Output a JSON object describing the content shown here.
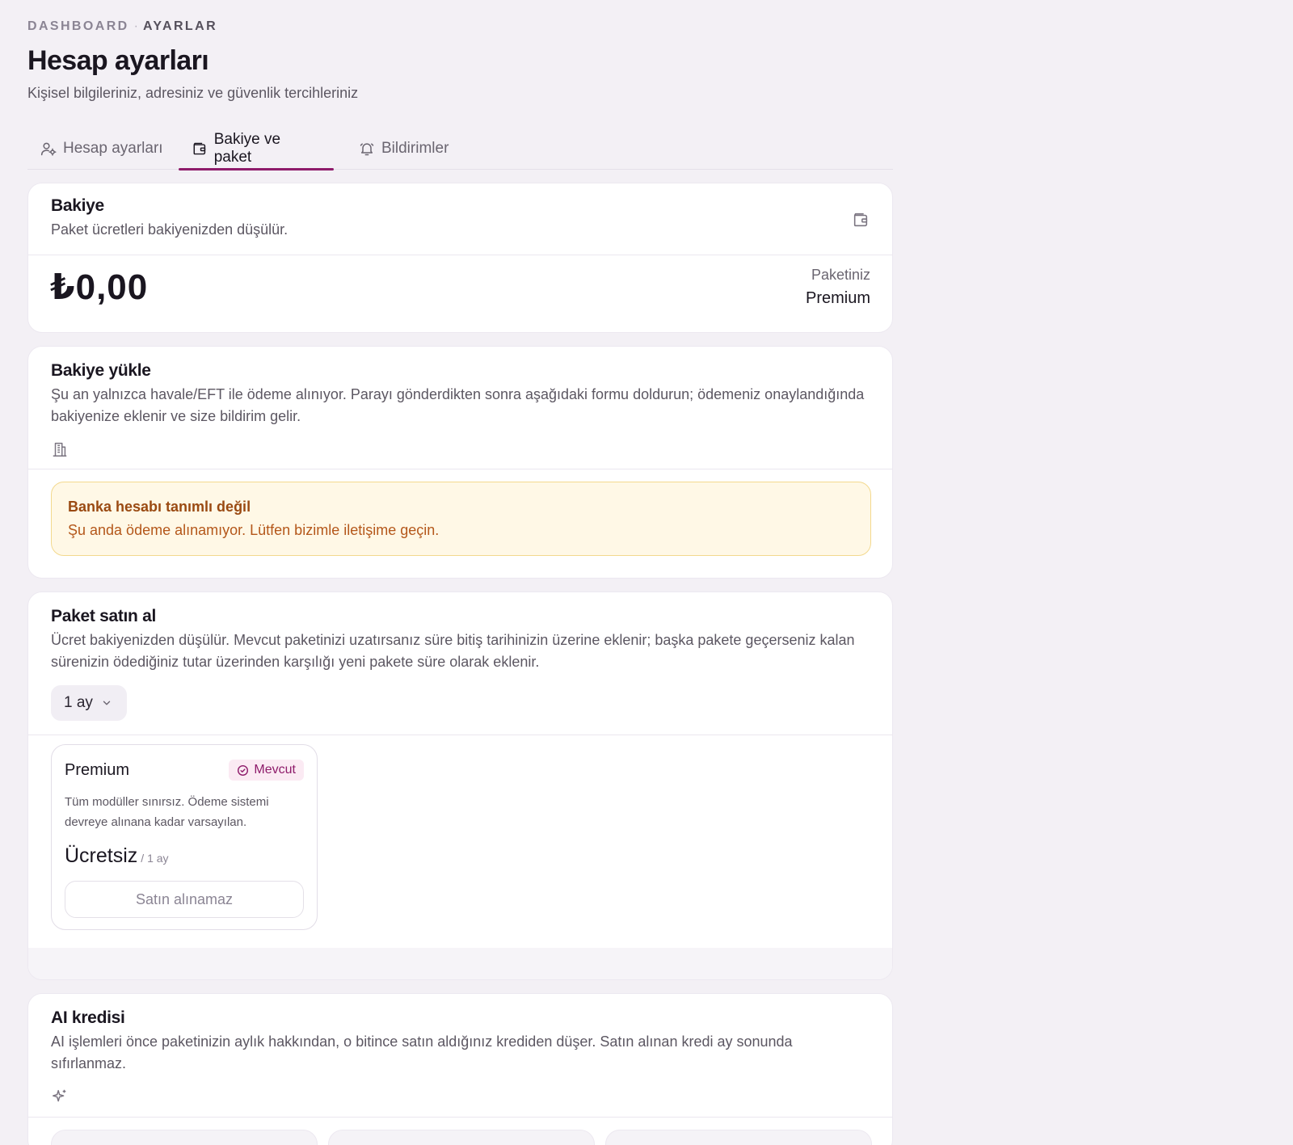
{
  "breadcrumb": {
    "root": "DASHBOARD",
    "separator": "·",
    "current": "AYARLAR"
  },
  "page": {
    "title": "Hesap ayarları",
    "subtitle": "Kişisel bilgileriniz, adresiniz ve güvenlik tercihleriniz"
  },
  "tabs": [
    {
      "label": "Hesap ayarları",
      "icon": "user-settings-icon",
      "active": false
    },
    {
      "label": "Bakiye ve paket",
      "icon": "wallet-icon",
      "active": true
    },
    {
      "label": "Bildirimler",
      "icon": "bell-icon",
      "active": false
    }
  ],
  "colors": {
    "accent": "#8e1b6a",
    "warning_bg": "#fff8e6",
    "warning_border": "#f3d98e",
    "warning_text": "#b4571a"
  },
  "balance_card": {
    "title": "Bakiye",
    "description": "Paket ücretleri bakiyenizden düşülür.",
    "amount": "₺0,00",
    "plan_label": "Paketiniz",
    "plan_value": "Premium"
  },
  "topup_card": {
    "title": "Bakiye yükle",
    "description": "Şu an yalnızca havale/EFT ile ödeme alınıyor. Parayı gönderdikten sonra aşağıdaki formu doldurun; ödemeniz onaylandığında bakiyenize eklenir ve size bildirim gelir.",
    "alert_title": "Banka hesabı tanımlı değil",
    "alert_text": "Şu anda ödeme alınamıyor. Lütfen bizimle iletişime geçin."
  },
  "buy_card": {
    "title": "Paket satın al",
    "description": "Ücret bakiyenizden düşülür. Mevcut paketinizi uzatırsanız süre bitiş tarihinizin üzerine eklenir; başka pakete geçerseniz kalan sürenizin ödediğiniz tutar üzerinden karşılığı yeni pakete süre olarak eklenir.",
    "period_selected": "1 ay",
    "plans": [
      {
        "name": "Premium",
        "badge": "Mevcut",
        "description": "Tüm modüller sınırsız. Ödeme sistemi devreye alınana kadar varsayılan.",
        "price": "Ücretsiz",
        "period": "/ 1 ay",
        "button": "Satın alınamaz"
      }
    ]
  },
  "ai_card": {
    "title": "AI kredisi",
    "description": "AI işlemleri önce paketinizin aylık hakkından, o bitince satın aldığınız krediden düşer. Satın alınan kredi ay sonunda sıfırlanmaz."
  }
}
